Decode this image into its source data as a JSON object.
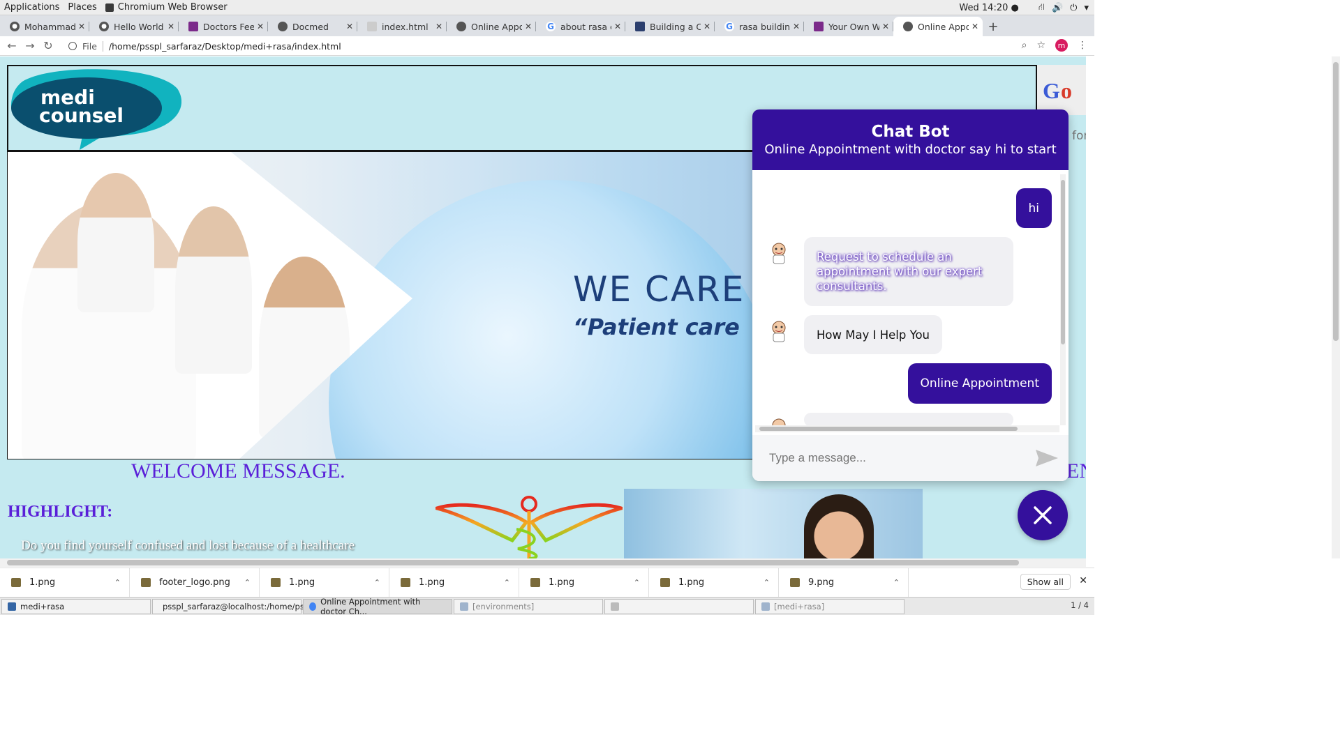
{
  "gnome": {
    "menus": [
      "Applications",
      "Places",
      "Chromium Web Browser"
    ],
    "clock": "Wed 14:20 ●"
  },
  "tabs": [
    {
      "title": "MohammadSa",
      "icon": "github-icon"
    },
    {
      "title": "Hello World",
      "icon": "github-icon"
    },
    {
      "title": "Doctors Feedb",
      "icon": "site-icon"
    },
    {
      "title": "Docmed",
      "icon": "globe-icon"
    },
    {
      "title": "index.html",
      "icon": "file-icon"
    },
    {
      "title": "Online Appoin",
      "icon": "globe-icon"
    },
    {
      "title": "about rasa cha",
      "icon": "google-icon"
    },
    {
      "title": "Building a Con",
      "icon": "site-icon"
    },
    {
      "title": "rasa building y",
      "icon": "google-icon"
    },
    {
      "title": "Your Own We",
      "icon": "site-icon"
    },
    {
      "title": "Online Appoin",
      "icon": "globe-icon",
      "active": true
    }
  ],
  "address": {
    "scheme": "File",
    "url": "/home/psspl_sarfaraz/Desktop/medi+rasa/index.html",
    "profile_initial": "m"
  },
  "site": {
    "logo_line1": "medi",
    "logo_line2": "counsel",
    "hero_title": "WE CARE",
    "hero_sub": "“Patient care",
    "hero_quote": "”",
    "welcome": "WELCOME MESSAGE.",
    "en_fragment": "EN",
    "highlight": "HIGHLIGHT:",
    "paragraph": "Do you find yourself confused and lost because of a healthcare",
    "right_fragment": "for"
  },
  "chat": {
    "title": "Chat Bot",
    "subtitle": "Online Appointment with doctor say hi to start",
    "messages": [
      {
        "from": "user",
        "text": "hi"
      },
      {
        "from": "bot",
        "text": "Request to schedule an appointment with our expert consultants."
      },
      {
        "from": "bot",
        "text": "How May I Help You"
      },
      {
        "from": "user",
        "text": "Online Appointment"
      }
    ],
    "placeholder": "Type a message...",
    "accent": "#34109c"
  },
  "downloads": {
    "items": [
      "1.png",
      "footer_logo.png",
      "1.png",
      "1.png",
      "1.png",
      "1.png",
      "9.png"
    ],
    "show_all": "Show all"
  },
  "taskbar": {
    "items": [
      {
        "label": "medi+rasa"
      },
      {
        "label": "psspl_sarfaraz@localhost:/home/pss..."
      },
      {
        "label": "Online Appointment with doctor Ch...",
        "active": true
      },
      {
        "label": "[environments]"
      },
      {
        "label": ""
      },
      {
        "label": "[medi+rasa]"
      }
    ],
    "pager": "1 / 4"
  }
}
